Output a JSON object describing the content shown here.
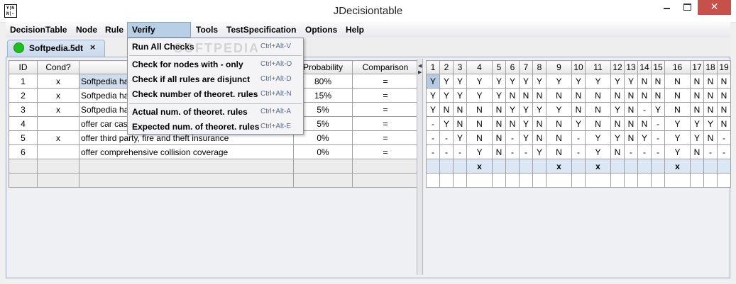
{
  "window": {
    "title": "JDecisiontable"
  },
  "window_controls": {
    "close": "✕"
  },
  "app_icon": {
    "line1": "Y|N",
    "line2": "N|-"
  },
  "menubar": [
    "DecisionTable",
    "Node",
    "Rule",
    "Verify D.Table",
    "Tools",
    "TestSpecification",
    "Options",
    "Help"
  ],
  "tab": {
    "label": "Softpedia.5dt",
    "close": "×"
  },
  "left_table": {
    "headers": [
      "ID",
      "Cond?",
      "",
      "Probability",
      "Comparison"
    ],
    "rows": [
      {
        "id": "1",
        "cond": "x",
        "text": "Softpedia ha",
        "prob": "80%",
        "cmp": "="
      },
      {
        "id": "2",
        "cond": "x",
        "text": "Softpedia ha",
        "prob": "15%",
        "cmp": "="
      },
      {
        "id": "3",
        "cond": "x",
        "text": "Softpedia ha",
        "prob": "5%",
        "cmp": "="
      },
      {
        "id": "4",
        "cond": "",
        "text": "offer car cas",
        "prob": "5%",
        "cmp": "="
      },
      {
        "id": "5",
        "cond": "x",
        "text": "offer third party, fire and theft insurance",
        "prob": "0%",
        "cmp": "="
      },
      {
        "id": "6",
        "cond": "",
        "text": "offer comprehensive collision coverage",
        "prob": "0%",
        "cmp": "="
      }
    ]
  },
  "rule_grid": {
    "columns": [
      "1",
      "2",
      "3",
      "4",
      "5",
      "6",
      "7",
      "8",
      "9",
      "10",
      "11",
      "12",
      "13",
      "14",
      "15",
      "16",
      "17",
      "18",
      "19"
    ],
    "rows": [
      [
        "Y",
        "Y",
        "Y",
        "Y",
        "Y",
        "Y",
        "Y",
        "Y",
        "Y",
        "Y",
        "Y",
        "Y",
        "Y",
        "N",
        "N",
        "N",
        "N",
        "N",
        "N"
      ],
      [
        "Y",
        "Y",
        "Y",
        "Y",
        "Y",
        "N",
        "N",
        "N",
        "N",
        "N",
        "N",
        "N",
        "N",
        "N",
        "N",
        "N",
        "N",
        "N",
        "N"
      ],
      [
        "Y",
        "N",
        "N",
        "N",
        "N",
        "Y",
        "Y",
        "Y",
        "Y",
        "N",
        "N",
        "Y",
        "N",
        "-",
        "Y",
        "N",
        "N",
        "N",
        "N"
      ],
      [
        "-",
        "Y",
        "N",
        "N",
        "N",
        "N",
        "Y",
        "N",
        "N",
        "Y",
        "N",
        "N",
        "N",
        "N",
        "-",
        "Y",
        "Y",
        "Y",
        "N"
      ],
      [
        "-",
        "-",
        "Y",
        "N",
        "N",
        "-",
        "Y",
        "N",
        "N",
        "-",
        "Y",
        "Y",
        "N",
        "Y",
        "-",
        "Y",
        "Y",
        "N",
        "-"
      ],
      [
        "-",
        "-",
        "-",
        "Y",
        "N",
        "-",
        "-",
        "Y",
        "N",
        "-",
        "Y",
        "N",
        "-",
        "-",
        "-",
        "Y",
        "N",
        "-",
        "-"
      ]
    ],
    "marks": [
      "",
      "",
      "",
      "x",
      "",
      "",
      "",
      "",
      "x",
      "",
      "x",
      "",
      "",
      "",
      "",
      "x",
      "",
      "",
      ""
    ]
  },
  "dropdown": {
    "items": [
      {
        "label": "Run All Checks",
        "shortcut": "Ctrl+Alt-V"
      },
      {
        "label": "Check for nodes with - only",
        "shortcut": "Ctrl+Alt-O"
      },
      {
        "label": "Check if all rules are disjunct",
        "shortcut": "Ctrl+Alt-D"
      },
      {
        "label": "Check number of theoret. rules",
        "shortcut": "Ctrl+Alt-N"
      },
      {
        "label": "Actual num. of theoret. rules",
        "shortcut": "Ctrl+Alt-A"
      },
      {
        "label": "Expected num. of theoret. rules",
        "shortcut": "Ctrl+Alt-E"
      }
    ]
  },
  "watermark": "SOFTPEDIA"
}
